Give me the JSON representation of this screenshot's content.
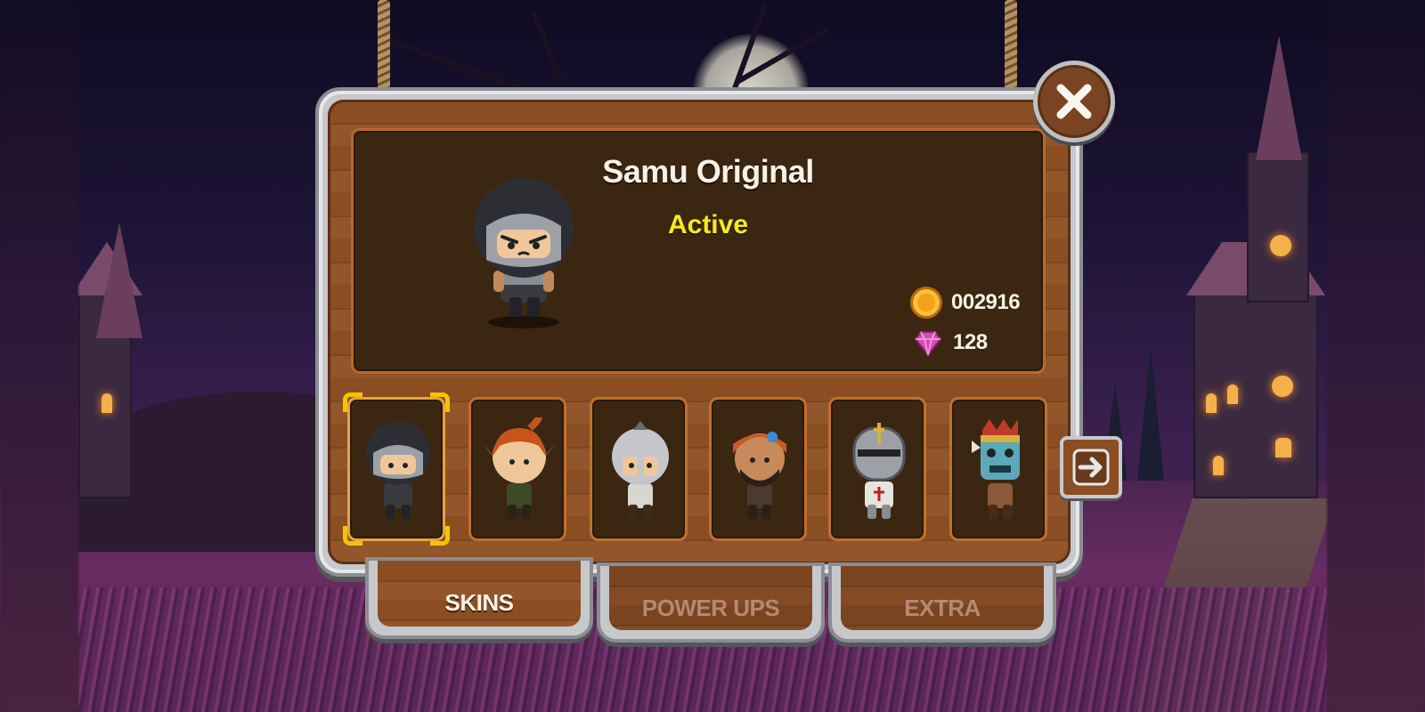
{
  "skin": {
    "title": "Samu Original",
    "status": "Active"
  },
  "currency": {
    "coins": "002916",
    "gems": "128"
  },
  "skins": [
    {
      "id": "samu-original",
      "selected": true
    },
    {
      "id": "elf-girl",
      "selected": false
    },
    {
      "id": "spartan",
      "selected": false
    },
    {
      "id": "desert-warrior",
      "selected": false
    },
    {
      "id": "crusader-knight",
      "selected": false
    },
    {
      "id": "tribal-mask",
      "selected": false
    }
  ],
  "tabs": [
    {
      "label": "SKINS",
      "active": true
    },
    {
      "label": "POWER UPS",
      "active": false
    },
    {
      "label": "EXTRA",
      "active": false
    }
  ],
  "icons": {
    "close": "close-icon",
    "next": "arrow-right-icon",
    "coin": "coin-icon",
    "gem": "gem-icon"
  },
  "colors": {
    "status_active": "#f3ea1c",
    "selection": "#f5c400",
    "coin": "#f3a01a",
    "gem": "#d84ab8"
  }
}
